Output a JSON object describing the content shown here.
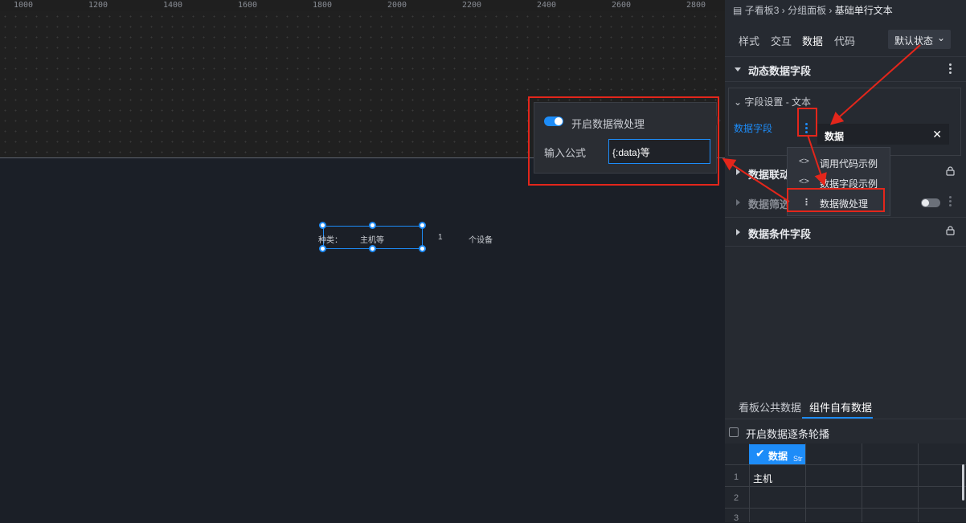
{
  "ruler": {
    "ticks": [
      "1000",
      "1200",
      "1400",
      "1600",
      "1800",
      "2000",
      "2200",
      "2400",
      "2600",
      "2800"
    ]
  },
  "canvas_widget": {
    "label": "种类：",
    "value": "主机等",
    "count": "1",
    "unit": "个设备"
  },
  "popover": {
    "toggle_label": "开启数据微处理",
    "toggle_on": true,
    "formula_label": "输入公式",
    "formula_value": "{:data}等"
  },
  "breadcrumb": {
    "items": [
      "子看板3",
      "分组面板",
      "基础单行文本"
    ]
  },
  "tabs": {
    "items": [
      "样式",
      "交互",
      "数据",
      "代码"
    ],
    "active": "数据"
  },
  "state_select": {
    "value": "默认状态"
  },
  "sections": {
    "dynamic": "动态数据字段",
    "field_settings": "字段设置 - 文本",
    "field_label": "数据字段",
    "field_value": "数据",
    "linkage": "数据联动",
    "filter": "数据筛选",
    "conditional": "数据条件字段"
  },
  "menu": {
    "items": [
      {
        "icon": "<>",
        "label": "调用代码示例"
      },
      {
        "icon": "<>",
        "label": "数据字段示例"
      },
      {
        "icon": "⋮",
        "label": "数据微处理"
      }
    ]
  },
  "data_panel": {
    "tabs": [
      "看板公共数据",
      "组件自有数据"
    ],
    "active_tab": "组件自有数据",
    "carousel_label": "开启数据逐条轮播",
    "column": {
      "name": "数据",
      "type": "Str"
    },
    "rows": [
      {
        "num": "1",
        "value": "主机"
      },
      {
        "num": "2",
        "value": ""
      },
      {
        "num": "3",
        "value": ""
      }
    ]
  },
  "colors": {
    "accent": "#1d8cf8",
    "annotation": "#e3261b",
    "panel_bg": "#262a31"
  }
}
